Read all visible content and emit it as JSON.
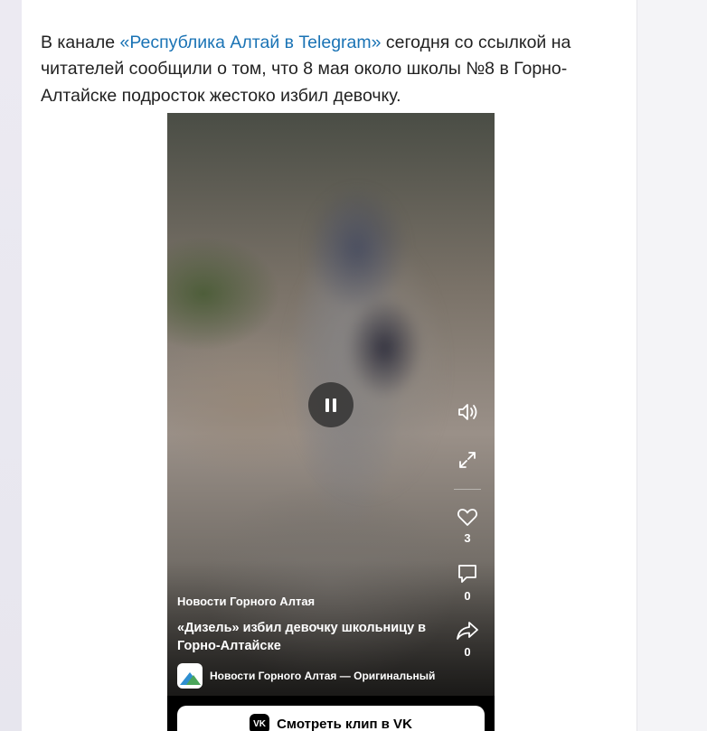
{
  "article": {
    "intro_prefix": "В канале ",
    "link_text": "«Республика Алтай в Telegram»",
    "intro_suffix": " сегодня со ссылкой на читателей сообщили о том, что 8 мая около школы №8 в Горно-Алтайске подросток жестоко избил девочку."
  },
  "video": {
    "clip_author": "Новости Горного Алтая",
    "clip_title": "«Дизель» избил девочку школьницу в Горно-Алтайске",
    "channel_name": "Новости Горного Алтая — Оригинальный з...",
    "likes_count": "3",
    "comments_count": "0",
    "shares_count": "0",
    "watch_button_label": "Смотреть клип в VK",
    "vk_logo_text": "VK",
    "icons": [
      "pause-icon",
      "volume-icon",
      "fullscreen-icon",
      "heart-icon",
      "comment-icon",
      "share-icon"
    ]
  },
  "colors": {
    "link": "#1a73b5",
    "text": "#222222",
    "page_bg": "#f4f4f7"
  }
}
